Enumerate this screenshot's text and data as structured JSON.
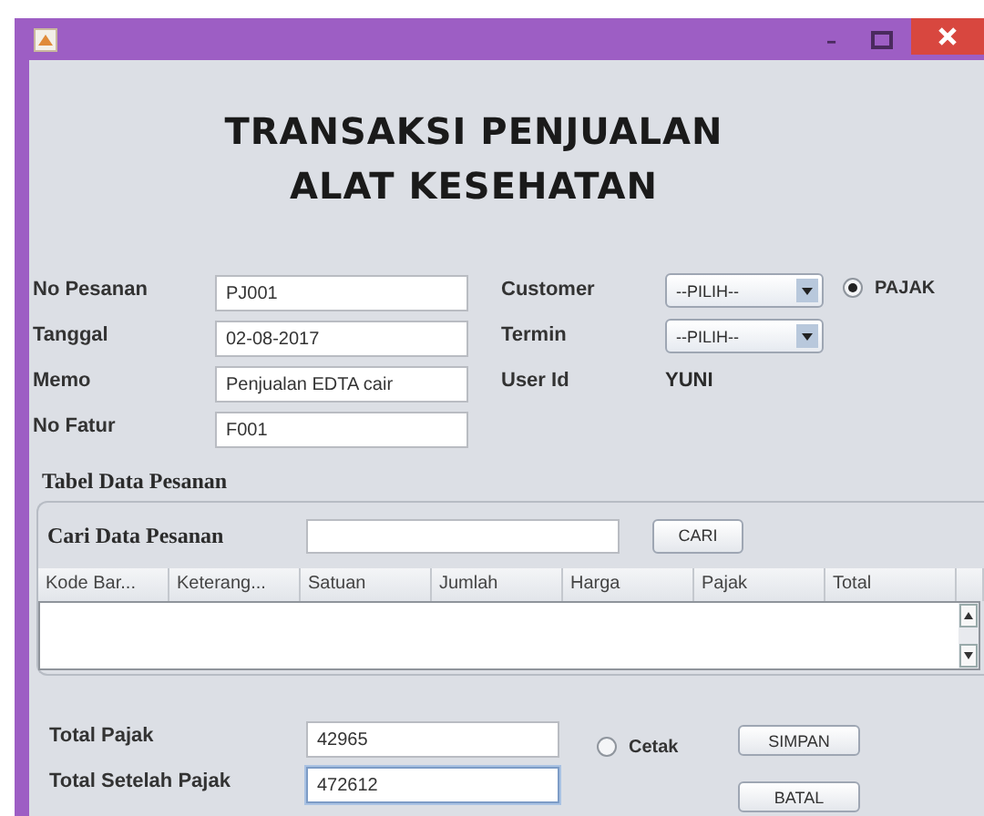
{
  "heading": [
    "TRANSAKSI PENJUALAN",
    "ALAT KESEHATAN"
  ],
  "fields": [
    {
      "label": "No Pesanan",
      "value": "PJ001"
    },
    {
      "label": "Tanggal",
      "value": "02-08-2017"
    },
    {
      "label": "Memo",
      "value": "Penjualan EDTA cair"
    },
    {
      "label": "No Fatur",
      "value": "F001"
    }
  ],
  "details": [
    {
      "kind": "combo",
      "label": "Customer",
      "value": "--PILIH--"
    },
    {
      "kind": "combo",
      "label": "Termin",
      "value": "--PILIH--"
    },
    {
      "kind": "text",
      "label": "User Id",
      "value": "YUNI"
    }
  ],
  "tax_option": {
    "label": "PAJAK",
    "selected": true
  },
  "table": {
    "title": "Tabel Data Pesanan",
    "search_label": "Cari Data Pesanan",
    "search_button": "CARI",
    "columns": [
      "Kode Bar...",
      "Keterang...",
      "Satuan",
      "Jumlah",
      "Harga",
      "Pajak",
      "Total"
    ]
  },
  "totals": [
    {
      "label": "Total Pajak",
      "value": "42965",
      "focused": false
    },
    {
      "label": "Total Setelah Pajak",
      "value": "472612",
      "focused": true
    }
  ],
  "print_option": {
    "label": "Cetak",
    "selected": false
  },
  "buttons": [
    "SIMPAN",
    "BATAL"
  ]
}
